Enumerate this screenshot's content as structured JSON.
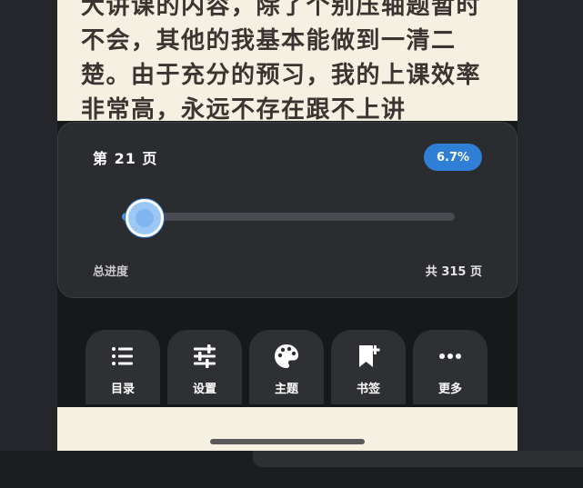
{
  "reader": {
    "text": "大讲课的内容，除了个别压轴题暂时不会，其他的我基本能做到一清二楚。由于充分的预习，我的上课效率非常高，永远不存在跟不上讲"
  },
  "progress": {
    "page_label": "第 21 页",
    "percent_label": "6.7%",
    "percent_value": 6.7,
    "total_label": "总进度",
    "total_pages_label": "共 315 页"
  },
  "actions": [
    {
      "label": "目录",
      "icon": "list-icon"
    },
    {
      "label": "设置",
      "icon": "sliders-icon"
    },
    {
      "label": "主题",
      "icon": "palette-icon"
    },
    {
      "label": "书签",
      "icon": "bookmark-add-icon"
    },
    {
      "label": "更多",
      "icon": "more-horizontal-icon"
    }
  ],
  "colors": {
    "accent": "#2f7fd6",
    "page_bg": "#f4f0e2",
    "panel_bg": "#2b2c2f"
  }
}
